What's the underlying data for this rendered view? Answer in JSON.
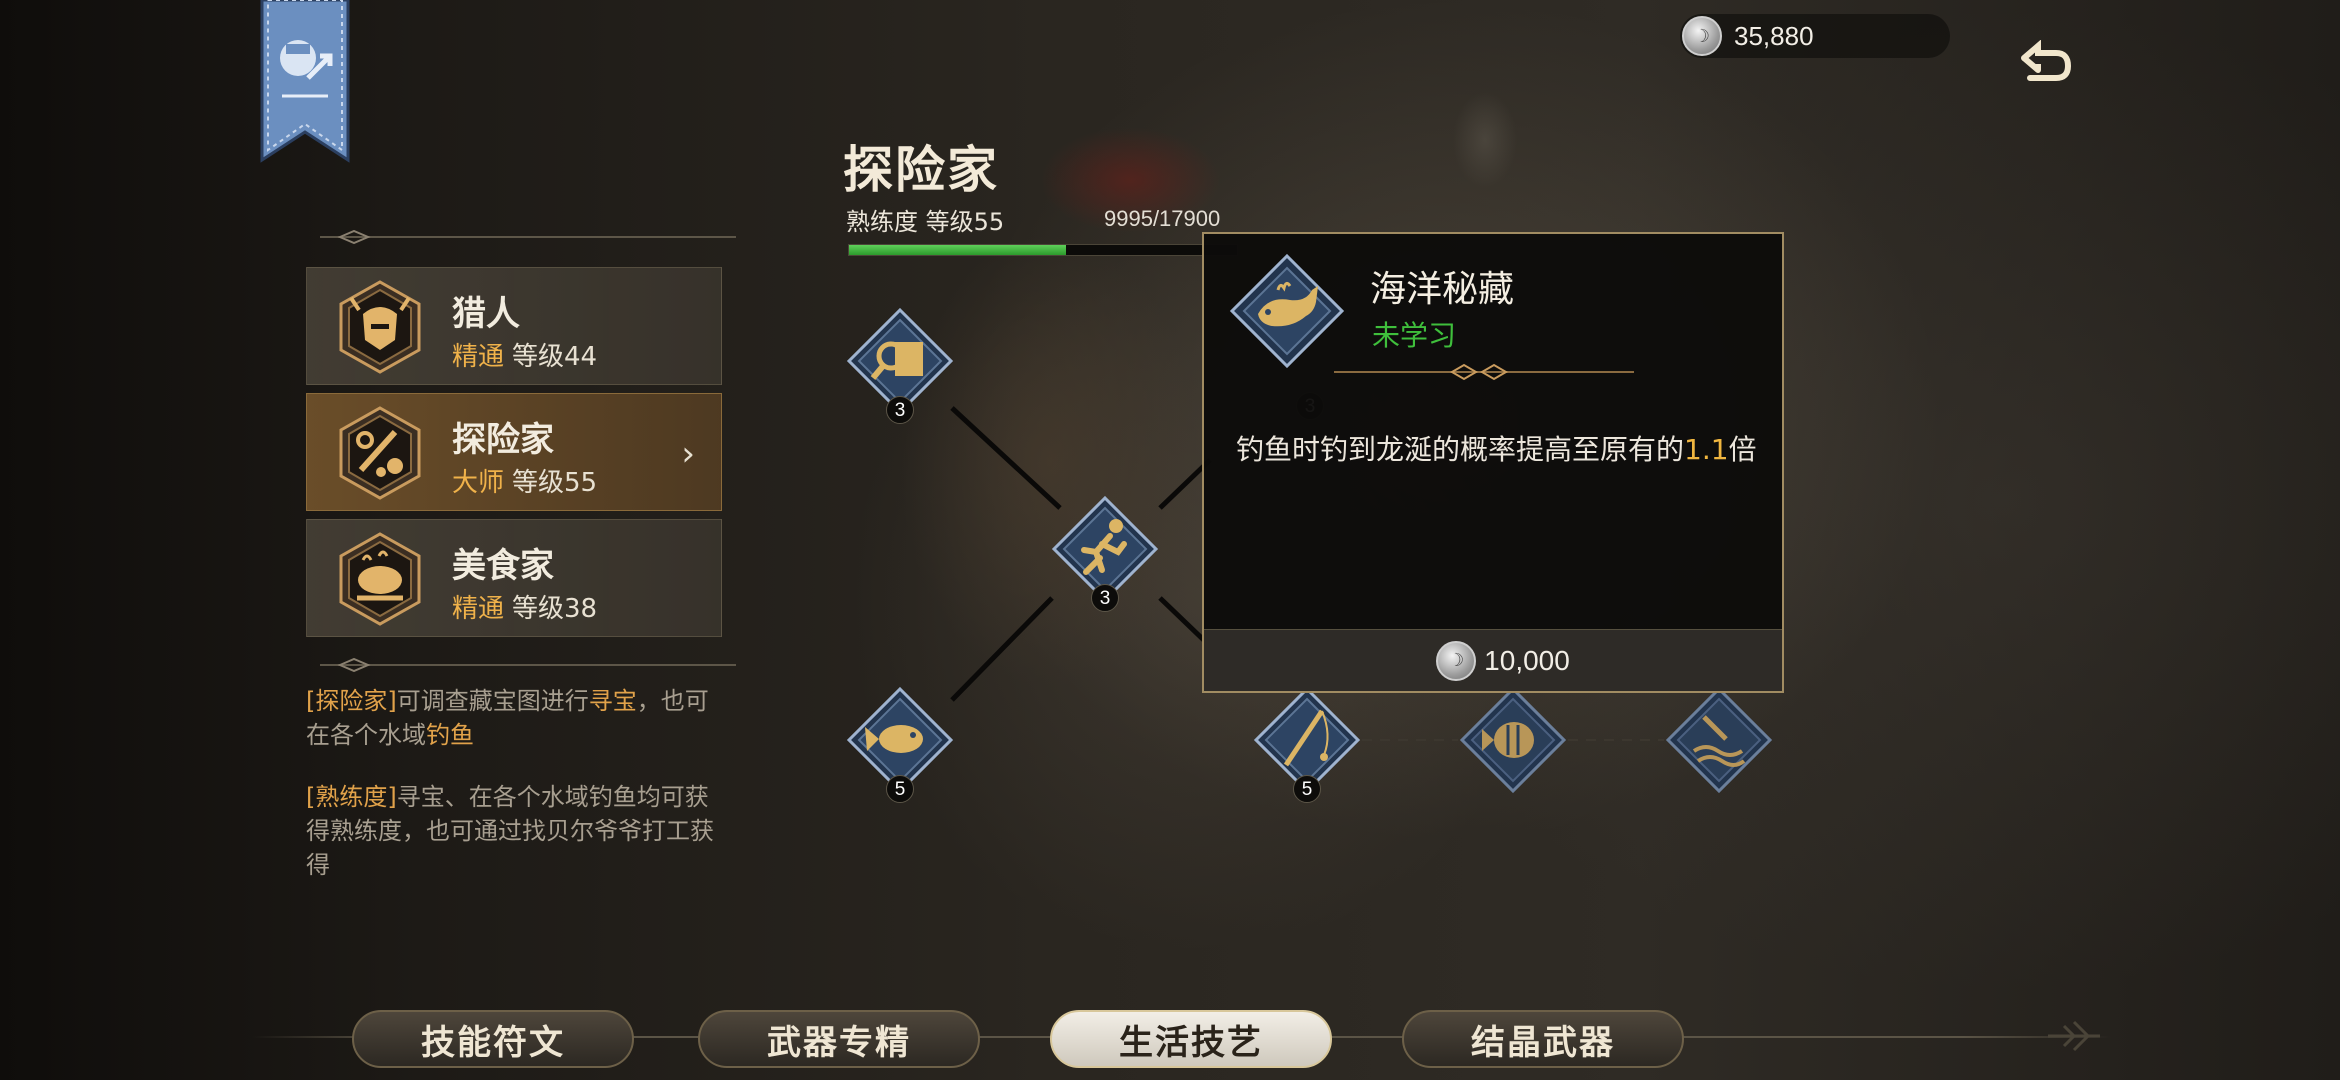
{
  "currency": {
    "amount": "35,880",
    "icon": "silver-coin-icon"
  },
  "header": {
    "title": "探险家",
    "proficiency_label": "熟练度 等级55",
    "proficiency_value": "9995/17900",
    "proficiency_fraction": 0.558
  },
  "classes": [
    {
      "name": "猎人",
      "rank": "精通",
      "level": "等级44",
      "icon": "hunter-helmet-icon",
      "active": false
    },
    {
      "name": "探险家",
      "rank": "大师",
      "level": "等级55",
      "icon": "explorer-tools-icon",
      "active": true
    },
    {
      "name": "美食家",
      "rank": "精通",
      "level": "等级38",
      "icon": "roast-chicken-icon",
      "active": false
    }
  ],
  "description": {
    "p1_tag": "[探险家]",
    "p1_text_a": "可调查藏宝图进行",
    "p1_hl_a": "寻宝",
    "p1_text_b": "，也可在各个水域",
    "p1_hl_b": "钓鱼",
    "p2_tag": "[熟练度]",
    "p2_text": "寻宝、在各个水域钓鱼均可获得熟练度，也可通过找贝尔爷爷打工获得"
  },
  "skill_nodes": [
    {
      "name": "treasure-map-icon",
      "count": "3"
    },
    {
      "name": "running-man-icon",
      "count": "3"
    },
    {
      "name": "fish-icon",
      "count": "5"
    },
    {
      "name": "fishing-rod-icon",
      "count": "5"
    },
    {
      "name": "tropical-fish-icon",
      "count": ""
    },
    {
      "name": "anchor-wave-icon",
      "count": ""
    },
    {
      "name": "hidden-node-count",
      "count": "3"
    }
  ],
  "tooltip": {
    "title": "海洋秘藏",
    "status": "未学习",
    "desc_a": "钓鱼时钓到龙涎的概率提高至原有的",
    "desc_num": "1.1",
    "desc_b": "倍",
    "cost": "10,000",
    "icon": "whale-icon"
  },
  "tabs": [
    {
      "label": "技能符文",
      "active": false
    },
    {
      "label": "武器专精",
      "active": false
    },
    {
      "label": "生活技艺",
      "active": true
    },
    {
      "label": "结晶武器",
      "active": false
    }
  ],
  "colors": {
    "accent_gold": "#f0b24a",
    "status_green": "#3fbf3c",
    "node_blue": "#2b3f5a",
    "node_gold": "#d9b56a"
  }
}
